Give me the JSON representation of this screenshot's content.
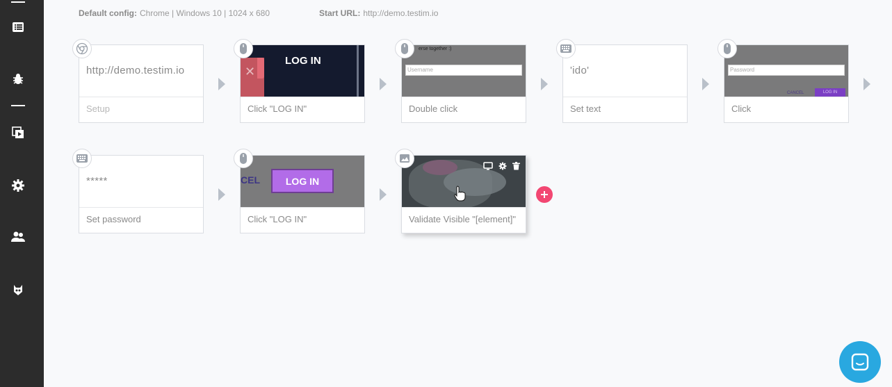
{
  "config": {
    "default_label": "Default config:",
    "default_value": "Chrome | Windows 10 | 1024 x 680",
    "start_label": "Start URL:",
    "start_value": "http://demo.testim.io"
  },
  "sidebar": {
    "icons": [
      "list-icon",
      "bug-icon",
      "play-suite-icon",
      "gear-icon",
      "users-icon",
      "mask-icon"
    ]
  },
  "steps": [
    {
      "value": "http://demo.testim.io",
      "label": "Setup",
      "icon": "chrome-icon"
    },
    {
      "thumb_text": "LOG IN",
      "label": "Click \"LOG IN\"",
      "icon": "mouse-icon"
    },
    {
      "thumb_text": "erse together :)",
      "field_text": "Username",
      "label": "Double click",
      "icon": "mouse-icon"
    },
    {
      "value": "'ido'",
      "label": "Set text",
      "icon": "keyboard-icon"
    },
    {
      "field_text": "Password",
      "cancel_text": "CANCEL",
      "login_text": "LOG IN",
      "label": "Click",
      "icon": "mouse-icon"
    },
    {
      "value": "*****",
      "label": "Set password",
      "icon": "keyboard-icon"
    },
    {
      "cel_text": "CEL",
      "thumb_text": "LOG IN",
      "label": "Click \"LOG IN\"",
      "icon": "mouse-icon"
    },
    {
      "label": "Validate Visible \"[element]\"",
      "icon": "image-icon"
    }
  ],
  "colors": {
    "sidebar": "#2c2c2c",
    "add_button": "#f24772",
    "chat_button": "#29a8e0",
    "arrow": "#b9c0c9"
  }
}
